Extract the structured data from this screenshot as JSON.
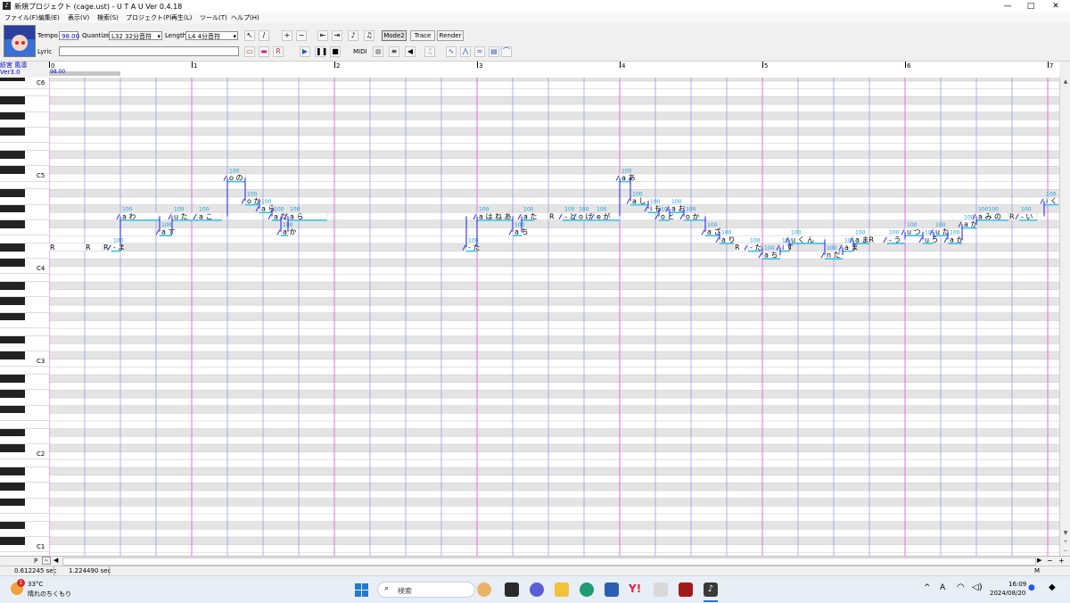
{
  "window": {
    "title": "新規プロジェクト (cage.ust) - U T A U  Ver 0.4.18",
    "app_icon": "♪",
    "minimize": "—",
    "maximize": "□",
    "close": "✕"
  },
  "menubar": [
    "ファイル(F)",
    "編集(E)",
    "表示(V)",
    "検索(S)",
    "プロジェクト(P)",
    "再生(L)",
    "ツール(T)",
    "ヘルプ(H)"
  ],
  "toolbar": {
    "tempo_label": "Tempo",
    "tempo_value": "98.00",
    "quantize_label": "Quantize",
    "quantize_value": "L32 32分音符",
    "length_label": "Length",
    "length_value": "L4  4分音符",
    "lyric_label": "Lyric",
    "lyric_value": "",
    "mode2": "Mode2",
    "trace": "Trace",
    "render": "Render",
    "midi": "MIDI"
  },
  "singer": {
    "name": "紡宮 風凛",
    "version": "Ver3.0"
  },
  "ruler": {
    "tempo": "98.00",
    "measures": [
      "0",
      "1",
      "2",
      "3",
      "4",
      "5",
      "6",
      "7"
    ]
  },
  "octave_labels": [
    "C6",
    "C5",
    "C4",
    "C3",
    "C2",
    "C1"
  ],
  "notes": [
    {
      "lyric": "R",
      "pitch": "E3",
      "start": 0,
      "len": 1.0,
      "vel": ""
    },
    {
      "lyric": "R",
      "pitch": "E3",
      "start": 1.0,
      "len": 0.5,
      "vel": ""
    },
    {
      "lyric": "R",
      "pitch": "E3",
      "start": 1.5,
      "len": 0.25,
      "vel": ""
    },
    {
      "lyric": "- よ",
      "pitch": "E3",
      "start": 1.75,
      "len": 0.25,
      "vel": "100"
    },
    {
      "lyric": "a わ",
      "pitch": "G3",
      "start": 2.0,
      "len": 1.1,
      "vel": "100"
    },
    {
      "lyric": "a す",
      "pitch": "F3",
      "start": 3.1,
      "len": 0.35,
      "vel": "100"
    },
    {
      "lyric": "u た",
      "pitch": "G3",
      "start": 3.45,
      "len": 0.7,
      "vel": "100"
    },
    {
      "lyric": "a こ",
      "pitch": "G3",
      "start": 4.15,
      "len": 0.7,
      "vel": "100"
    },
    {
      "lyric": "o の",
      "pitch": "C4",
      "start": 5.0,
      "len": 0.5,
      "vel": "100"
    },
    {
      "lyric": "o か",
      "pitch": "A3",
      "start": 5.5,
      "len": 0.4,
      "vel": "100"
    },
    {
      "lyric": "a ら",
      "pitch": "G3+",
      "start": 5.9,
      "len": 0.35,
      "vel": "100"
    },
    {
      "lyric": "a だ",
      "pitch": "G3",
      "start": 6.25,
      "len": 0.25,
      "vel": "100"
    },
    {
      "lyric": "a か",
      "pitch": "F3",
      "start": 6.5,
      "len": 0.2,
      "vel": "100"
    },
    {
      "lyric": "a ら",
      "pitch": "G3",
      "start": 6.7,
      "len": 1.1,
      "vel": "100"
    },
    {
      "lyric": "- た",
      "pitch": "E3",
      "start": 11.7,
      "len": 0.3,
      "vel": "100"
    },
    {
      "lyric": "a は ね あ",
      "pitch": "G3",
      "start": 12.0,
      "len": 1.0,
      "vel": "100"
    },
    {
      "lyric": "a ち",
      "pitch": "F3",
      "start": 13.0,
      "len": 0.25,
      "vel": "100"
    },
    {
      "lyric": "a た",
      "pitch": "G3",
      "start": 13.25,
      "len": 0.35,
      "vel": "100"
    },
    {
      "lyric": "R",
      "pitch": "G3",
      "start": 14.0,
      "len": 0.4,
      "vel": ""
    },
    {
      "lyric": "- と",
      "pitch": "G3",
      "start": 14.4,
      "len": 0.4,
      "vel": "100"
    },
    {
      "lyric": "o げ",
      "pitch": "G3",
      "start": 14.8,
      "len": 0.5,
      "vel": "100"
    },
    {
      "lyric": "e が",
      "pitch": "G3",
      "start": 15.3,
      "len": 0.7,
      "vel": "100"
    },
    {
      "lyric": "a あ",
      "pitch": "C4",
      "start": 16.0,
      "len": 0.3,
      "vel": "100"
    },
    {
      "lyric": "a し",
      "pitch": "A3",
      "start": 16.3,
      "len": 0.5,
      "vel": "100"
    },
    {
      "lyric": "i も",
      "pitch": "G3+",
      "start": 16.8,
      "len": 0.3,
      "vel": "100"
    },
    {
      "lyric": "o と",
      "pitch": "G3",
      "start": 17.1,
      "len": 0.3,
      "vel": "100"
    },
    {
      "lyric": "a お",
      "pitch": "G3+",
      "start": 17.4,
      "len": 0.4,
      "vel": "100"
    },
    {
      "lyric": "o か",
      "pitch": "G3",
      "start": 17.8,
      "len": 0.6,
      "vel": "100"
    },
    {
      "lyric": "a ざ",
      "pitch": "F3",
      "start": 18.4,
      "len": 0.4,
      "vel": "100"
    },
    {
      "lyric": "a り",
      "pitch": "E3+",
      "start": 18.8,
      "len": 0.4,
      "vel": "100"
    },
    {
      "lyric": "R",
      "pitch": "E3",
      "start": 19.2,
      "len": 0.4,
      "vel": ""
    },
    {
      "lyric": "- た",
      "pitch": "E3",
      "start": 19.6,
      "len": 0.35,
      "vel": "100"
    },
    {
      "lyric": "a ち",
      "pitch": "D3",
      "start": 20.0,
      "len": 0.5,
      "vel": "100"
    },
    {
      "lyric": "i す",
      "pitch": "E3",
      "start": 20.5,
      "len": 0.25,
      "vel": "100"
    },
    {
      "lyric": "u く ん",
      "pitch": "E3+",
      "start": 20.75,
      "len": 1.0,
      "vel": "100"
    },
    {
      "lyric": "n だ",
      "pitch": "D3",
      "start": 21.75,
      "len": 0.5,
      "vel": "100"
    },
    {
      "lyric": "a ま",
      "pitch": "E3",
      "start": 22.25,
      "len": 0.3,
      "vel": "100"
    },
    {
      "lyric": "a まR",
      "pitch": "E3+",
      "start": 22.55,
      "len": 0.45,
      "vel": "100"
    },
    {
      "lyric": "- う",
      "pitch": "E3+",
      "start": 23.5,
      "len": 0.5,
      "vel": "100"
    },
    {
      "lyric": "u つ",
      "pitch": "F3",
      "start": 24.0,
      "len": 0.5,
      "vel": "100"
    },
    {
      "lyric": "u う",
      "pitch": "E3+",
      "start": 24.5,
      "len": 0.3,
      "vel": "100"
    },
    {
      "lyric": "u た",
      "pitch": "F3",
      "start": 24.8,
      "len": 0.4,
      "vel": "100"
    },
    {
      "lyric": "a か",
      "pitch": "E3+",
      "start": 25.2,
      "len": 0.4,
      "vel": "100"
    },
    {
      "lyric": "a が",
      "pitch": "F3+",
      "start": 25.6,
      "len": 0.4,
      "vel": "100"
    },
    {
      "lyric": "a み の",
      "pitch": "G3",
      "start": 26.0,
      "len": 0.9,
      "vel": "100100"
    },
    {
      "lyric": "R",
      "pitch": "G3",
      "start": 26.9,
      "len": 0.3,
      "vel": ""
    },
    {
      "lyric": "- い",
      "pitch": "G3",
      "start": 27.2,
      "len": 0.5,
      "vel": "100"
    },
    {
      "lyric": "i く",
      "pitch": "A3",
      "start": 27.9,
      "len": 0.4,
      "vel": "100"
    }
  ],
  "status": {
    "left": "0.612245 sec",
    "right": "1.224490 sec",
    "corner": "M",
    "part": "P"
  },
  "taskbar": {
    "weather_temp": "33°C",
    "weather_desc": "晴れのちくもり",
    "weather_badge": "1",
    "search_placeholder": "検索",
    "time": "16:09",
    "date": "2024/08/20",
    "tray": [
      "^",
      "A",
      "wifi-icon",
      "speaker-icon"
    ],
    "apps": [
      "start-icon",
      "search-icon",
      "lion-icon",
      "taskview-icon",
      "chat-icon",
      "explorer-icon",
      "edge-icon",
      "store-icon",
      "yahoo-icon",
      "app-icon",
      "media-icon",
      "utau-icon"
    ]
  },
  "colors": {
    "measure_line": "#e070e0",
    "beat_line": "#9090ee",
    "black_key_row": "#e4e4e4",
    "note_line": "#33c0e8",
    "pitch_line": "#1a1aee",
    "singer_text": "#0000cc"
  }
}
